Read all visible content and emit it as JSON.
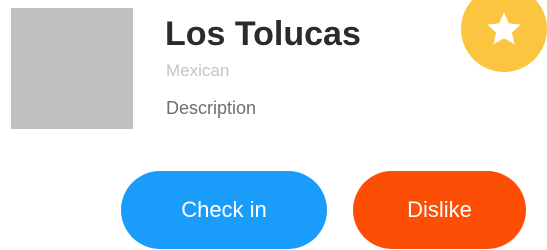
{
  "restaurant": {
    "name": "Los Tolucas",
    "cuisine": "Mexican",
    "description": "Description"
  },
  "favorite": {
    "icon": "star-icon",
    "color": "#fcc540"
  },
  "actions": {
    "checkin_label": "Check in",
    "checkin_color": "#1a9cfb",
    "dislike_label": "Dislike",
    "dislike_color": "#fd4e06"
  }
}
